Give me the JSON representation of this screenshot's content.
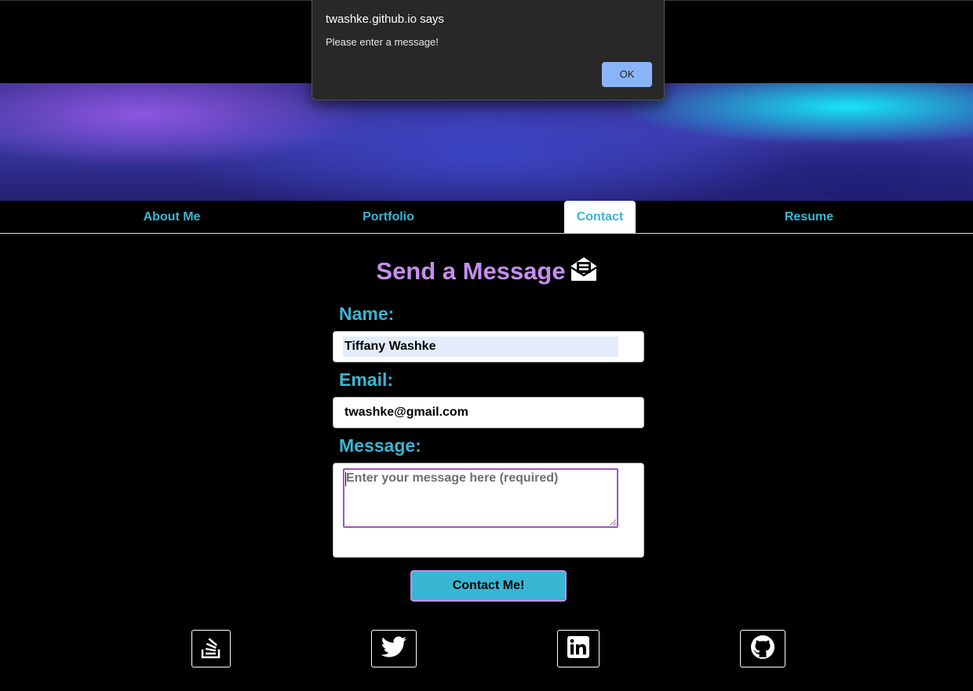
{
  "nav": {
    "items": [
      {
        "label": "About Me",
        "active": false
      },
      {
        "label": "Portfolio",
        "active": false
      },
      {
        "label": "Contact",
        "active": true
      },
      {
        "label": "Resume",
        "active": false
      }
    ]
  },
  "form": {
    "title": "Send a Message",
    "title_icon": "envelope-open-text-icon",
    "name_label": "Name:",
    "name_value": "Tiffany Washke",
    "email_label": "Email:",
    "email_value": "twashke@gmail.com",
    "message_label": "Message:",
    "message_value": "",
    "message_placeholder": "Enter your message here (required)",
    "submit_label": "Contact Me!"
  },
  "social": [
    {
      "icon": "stack-overflow-icon"
    },
    {
      "icon": "twitter-icon"
    },
    {
      "icon": "linkedin-icon"
    },
    {
      "icon": "github-icon"
    }
  ],
  "dialog": {
    "origin": "twashke.github.io says",
    "message": "Please enter a message!",
    "ok_label": "OK"
  },
  "colors": {
    "accent_cyan": "#38b6d3",
    "accent_purple": "#c78df0",
    "dialog_button": "#8ab4f8"
  }
}
